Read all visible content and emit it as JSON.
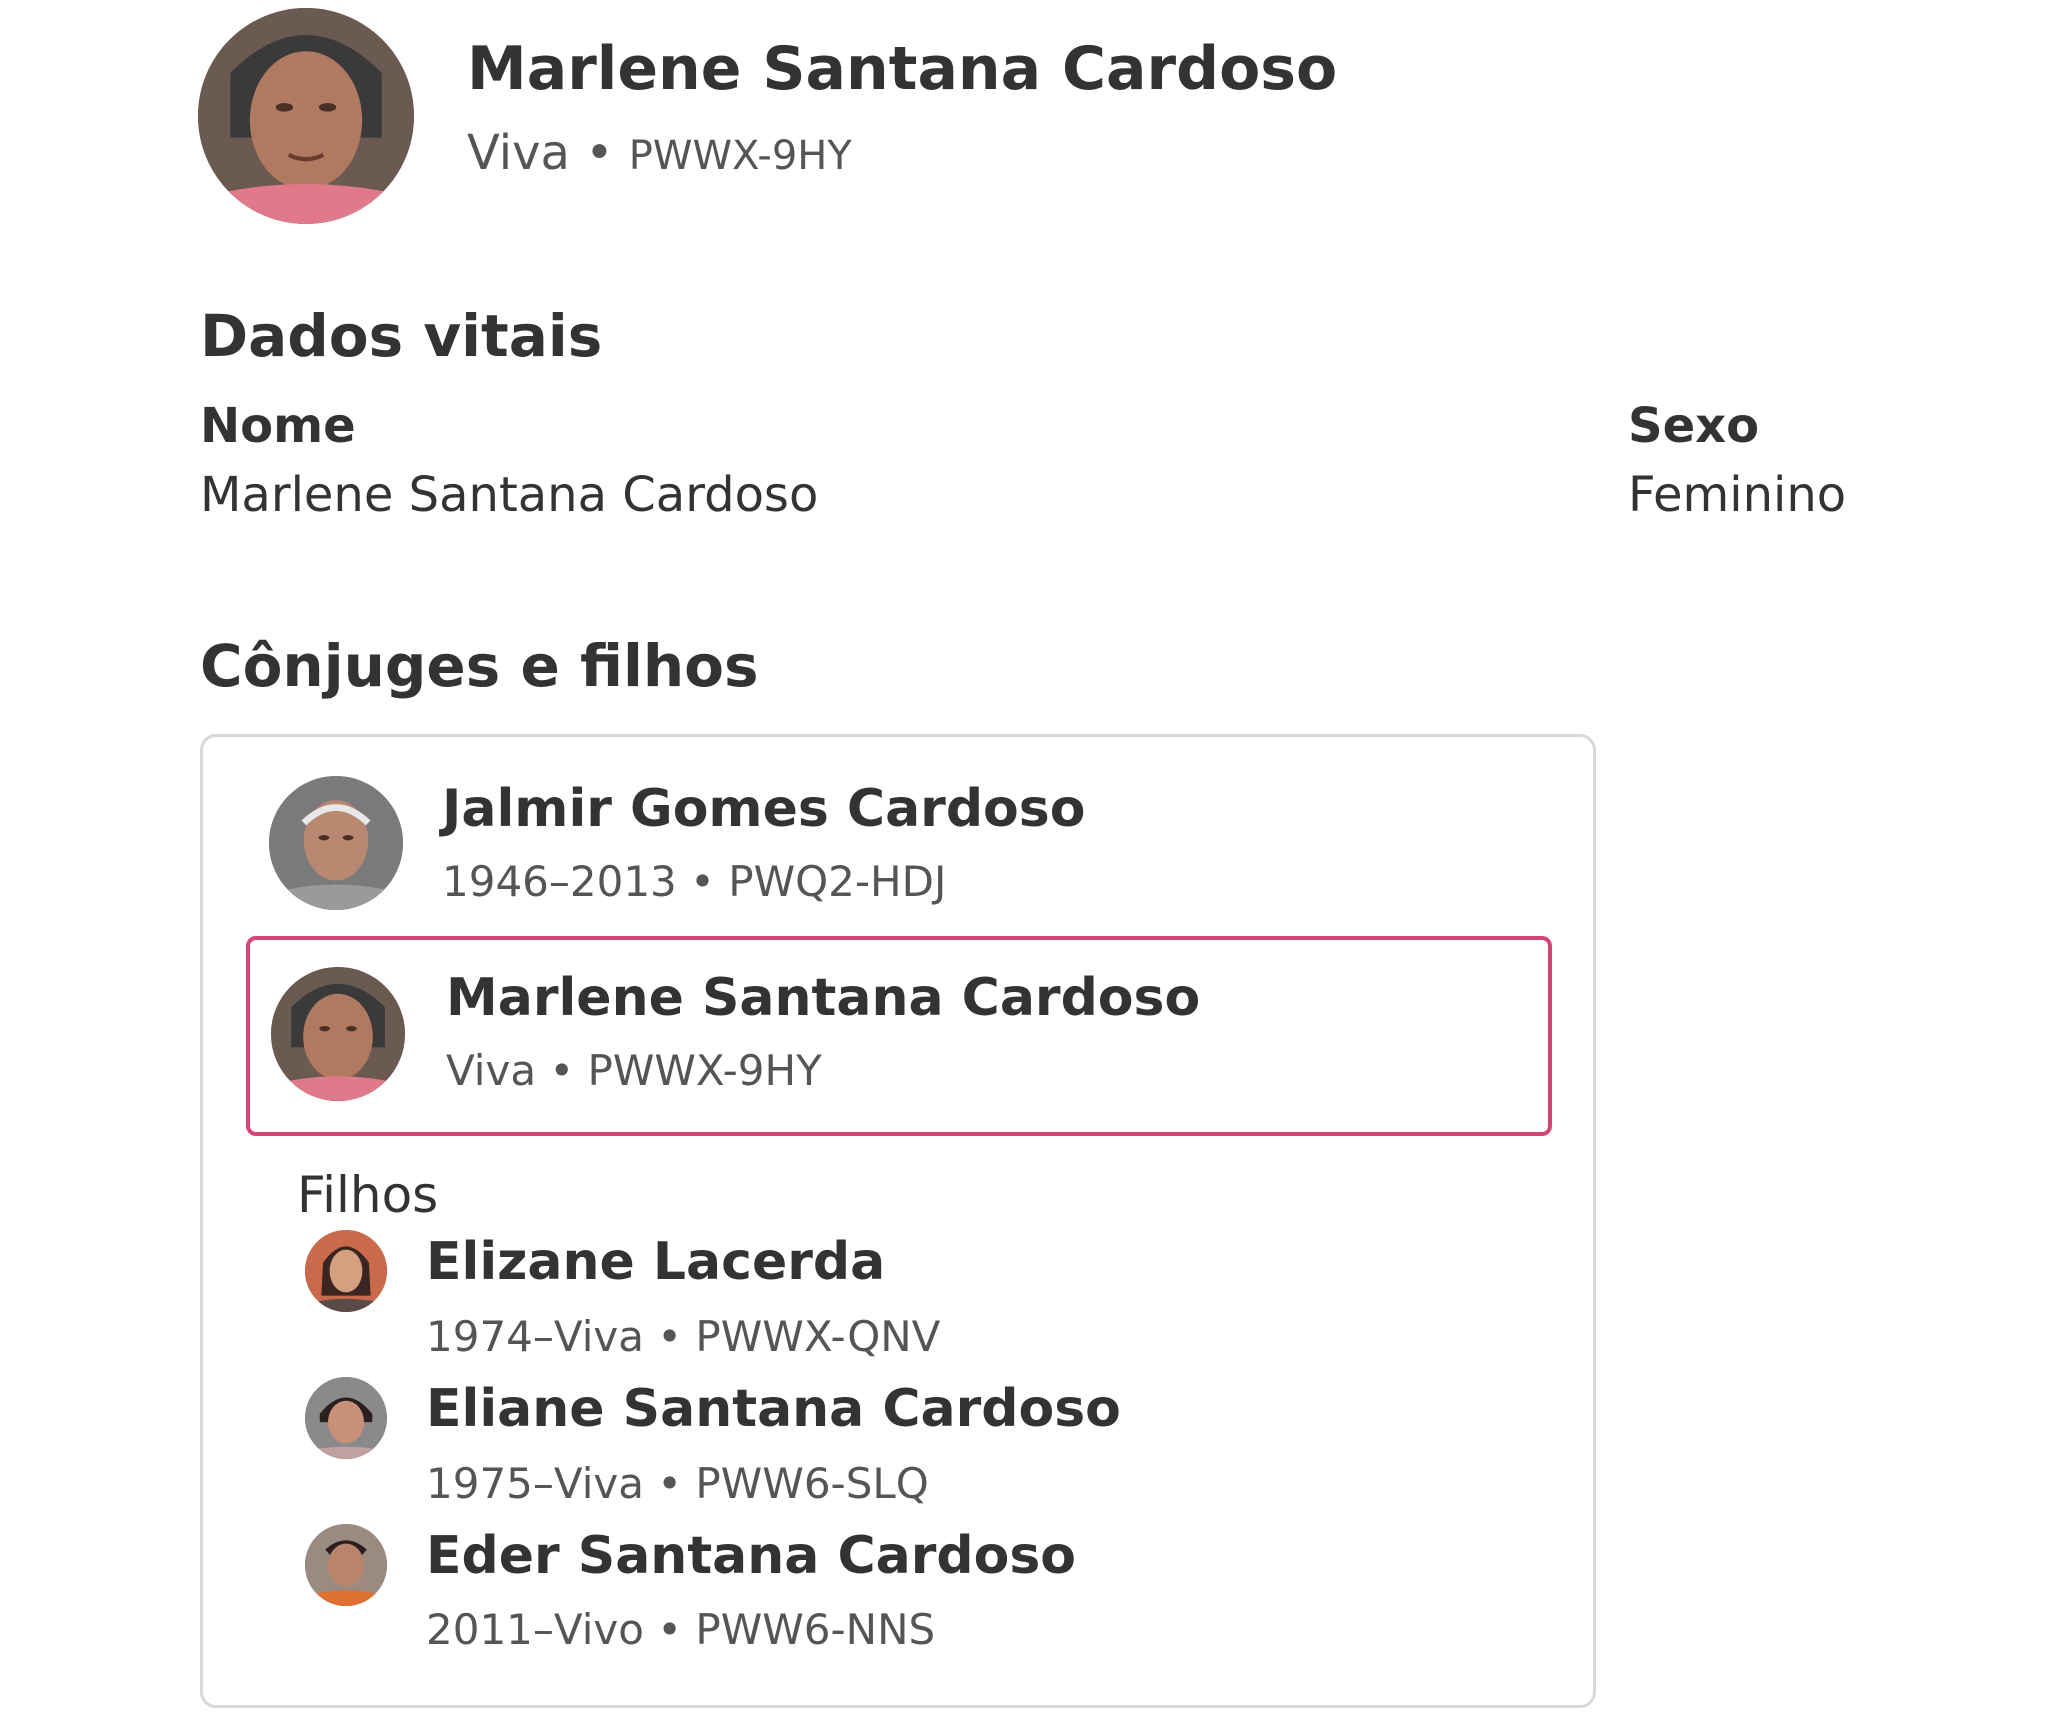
{
  "header": {
    "name": "Marlene Santana Cardoso",
    "status": "Viva",
    "separator": "•",
    "pid": "PWWX-9HY",
    "avatar_icon": "profile-photo"
  },
  "vitals": {
    "title": "Dados vitais",
    "name_label": "Nome",
    "name_value": "Marlene Santana Cardoso",
    "sex_label": "Sexo",
    "sex_value": "Feminino"
  },
  "family": {
    "title": "Cônjuges e filhos",
    "spouse": {
      "name": "Jalmir Gomes Cardoso",
      "detail": "1946–2013 • PWQ2-HDJ"
    },
    "focus": {
      "name": "Marlene Santana Cardoso",
      "detail": "Viva • PWWX-9HY",
      "highlight_color": "#d64577"
    },
    "children_label": "Filhos",
    "children": [
      {
        "name": "Elizane Lacerda",
        "detail": "1974–Viva • PWWX-QNV"
      },
      {
        "name": "Eliane Santana Cardoso",
        "detail": "1975–Viva • PWW6-SLQ"
      },
      {
        "name": "Eder Santana Cardoso",
        "detail": "2011–Vivo • PWW6-NNS"
      }
    ]
  }
}
